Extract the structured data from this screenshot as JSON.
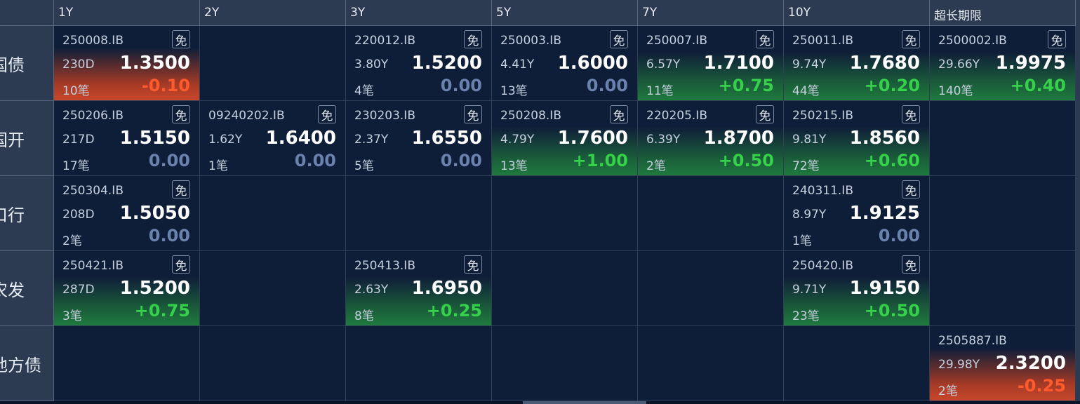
{
  "columns": [
    "1Y",
    "2Y",
    "3Y",
    "5Y",
    "7Y",
    "10Y",
    "超长期限"
  ],
  "rows": [
    {
      "label": "国债",
      "cells": [
        {
          "code": "250008.IB",
          "tag": "免",
          "term": "230D",
          "yield": "1.3500",
          "count": "10笔",
          "change": "-0.10",
          "trend": "down"
        },
        null,
        {
          "code": "220012.IB",
          "tag": "免",
          "term": "3.80Y",
          "yield": "1.5200",
          "count": "4笔",
          "change": "0.00",
          "trend": "flat"
        },
        {
          "code": "250003.IB",
          "tag": "免",
          "term": "4.41Y",
          "yield": "1.6000",
          "count": "13笔",
          "change": "0.00",
          "trend": "flat"
        },
        {
          "code": "250007.IB",
          "tag": "免",
          "term": "6.57Y",
          "yield": "1.7100",
          "count": "11笔",
          "change": "+0.75",
          "trend": "up"
        },
        {
          "code": "250011.IB",
          "tag": "免",
          "term": "9.74Y",
          "yield": "1.7680",
          "count": "44笔",
          "change": "+0.20",
          "trend": "up"
        },
        {
          "code": "2500002.IB",
          "tag": "免",
          "term": "29.66Y",
          "yield": "1.9975",
          "count": "140笔",
          "change": "+0.40",
          "trend": "up"
        }
      ]
    },
    {
      "label": "国开",
      "cells": [
        {
          "code": "250206.IB",
          "tag": "免",
          "term": "217D",
          "yield": "1.5150",
          "count": "17笔",
          "change": "0.00",
          "trend": "flat"
        },
        {
          "code": "09240202.IB",
          "tag": "免",
          "term": "1.62Y",
          "yield": "1.6400",
          "count": "1笔",
          "change": "0.00",
          "trend": "flat"
        },
        {
          "code": "230203.IB",
          "tag": "免",
          "term": "2.37Y",
          "yield": "1.6550",
          "count": "5笔",
          "change": "0.00",
          "trend": "flat"
        },
        {
          "code": "250208.IB",
          "tag": "免",
          "term": "4.79Y",
          "yield": "1.7600",
          "count": "13笔",
          "change": "+1.00",
          "trend": "up"
        },
        {
          "code": "220205.IB",
          "tag": "免",
          "term": "6.39Y",
          "yield": "1.8700",
          "count": "2笔",
          "change": "+0.50",
          "trend": "up"
        },
        {
          "code": "250215.IB",
          "tag": "免",
          "term": "9.81Y",
          "yield": "1.8560",
          "count": "72笔",
          "change": "+0.60",
          "trend": "up"
        },
        null
      ]
    },
    {
      "label": "口行",
      "cells": [
        {
          "code": "250304.IB",
          "tag": "免",
          "term": "208D",
          "yield": "1.5050",
          "count": "2笔",
          "change": "0.00",
          "trend": "flat"
        },
        null,
        null,
        null,
        null,
        {
          "code": "240311.IB",
          "tag": "免",
          "term": "8.97Y",
          "yield": "1.9125",
          "count": "1笔",
          "change": "0.00",
          "trend": "flat"
        },
        null
      ]
    },
    {
      "label": "农发",
      "cells": [
        {
          "code": "250421.IB",
          "tag": "免",
          "term": "287D",
          "yield": "1.5200",
          "count": "3笔",
          "change": "+0.75",
          "trend": "up"
        },
        null,
        {
          "code": "250413.IB",
          "tag": "免",
          "term": "2.63Y",
          "yield": "1.6950",
          "count": "8笔",
          "change": "+0.25",
          "trend": "up"
        },
        null,
        null,
        {
          "code": "250420.IB",
          "tag": "免",
          "term": "9.71Y",
          "yield": "1.9150",
          "count": "23笔",
          "change": "+0.50",
          "trend": "up"
        },
        null
      ]
    },
    {
      "label": "地方债",
      "cells": [
        null,
        null,
        null,
        null,
        null,
        null,
        {
          "code": "2505887.IB",
          "tag": "",
          "term": "29.98Y",
          "yield": "2.3200",
          "count": "2笔",
          "change": "-0.25",
          "trend": "down"
        }
      ]
    }
  ],
  "colors": {
    "up": "#35d14a",
    "down": "#ff5a2c",
    "flat": "#6b82ad",
    "background": "#0d1a33",
    "header": "#2c3a52"
  }
}
